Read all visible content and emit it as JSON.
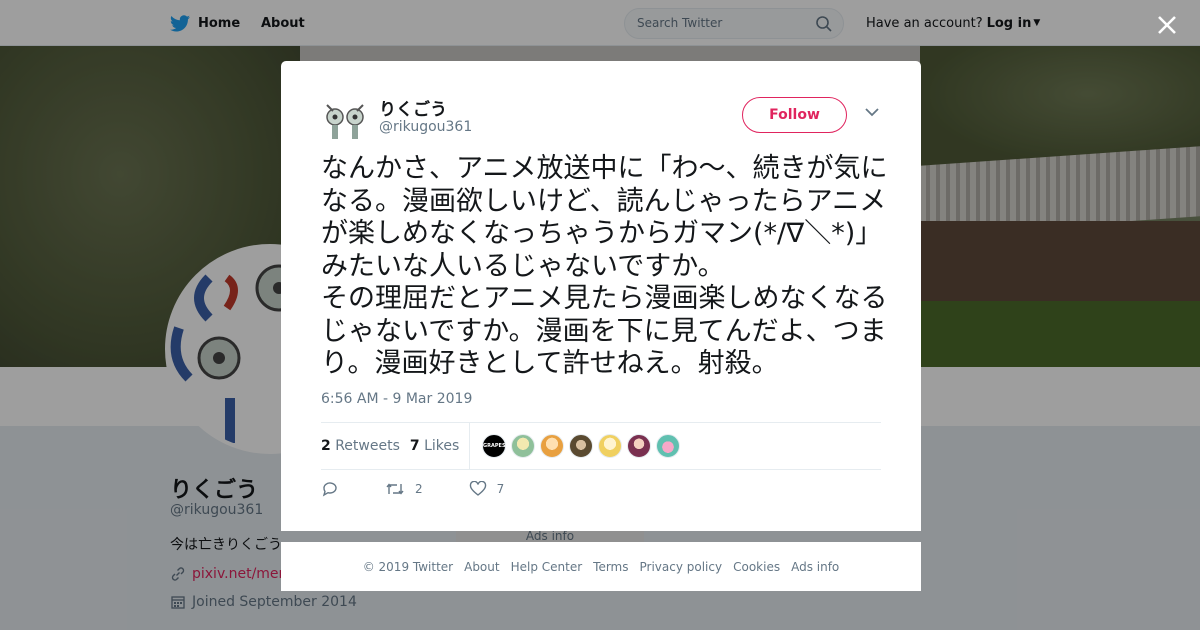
{
  "nav": {
    "home": "Home",
    "about": "About",
    "search_placeholder": "Search Twitter",
    "have_account": "Have an account?",
    "login": "Log in"
  },
  "profile": {
    "name": "りくごう",
    "handle": "@rikugou361",
    "bio": "今は亡きりくごう",
    "link": "pixiv.net/memb",
    "joined": "Joined September 2014"
  },
  "tweet": {
    "name": "りくごう",
    "handle": "@rikugou361",
    "follow": "Follow",
    "text": "なんかさ、アニメ放送中に「わ～、続きが気になる。漫画欲しいけど、読んじゃったらアニメが楽しめなくなっちゃうからガマン(*/∇＼*)」みたいな人いるじゃないですか。\nその理屈だとアニメ見たら漫画楽しめなくなるじゃないですか。漫画を下に見てんだよ、つまり。漫画好きとして許せねえ。射殺。",
    "time": "6:56 AM - 9 Mar 2019",
    "retweets_count": "2",
    "retweets_label": "Retweets",
    "likes_count": "7",
    "likes_label": "Likes",
    "action_retweets": "2",
    "action_likes": "7",
    "liker_avatars": [
      "GRAPES",
      "avatar-2",
      "avatar-3",
      "avatar-4",
      "avatar-5",
      "avatar-6",
      "avatar-7"
    ]
  },
  "ads_peek": "Ads info",
  "footer": {
    "items": [
      "© 2019 Twitter",
      "About",
      "Help Center",
      "Terms",
      "Privacy policy",
      "Cookies",
      "Ads info"
    ]
  },
  "colors": {
    "brand": "#1da1f2",
    "accent": "#e0245e",
    "muted": "#657786"
  }
}
